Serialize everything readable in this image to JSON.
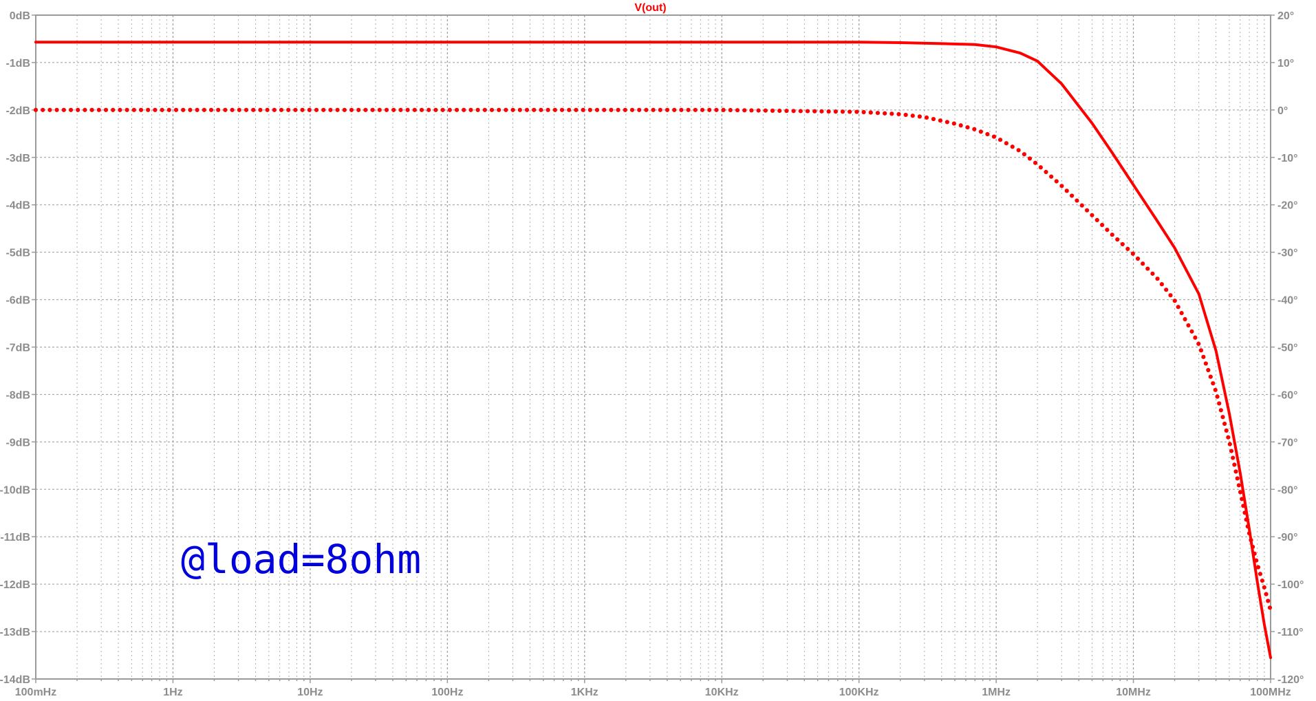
{
  "colors": {
    "trace": "#ff0000",
    "annotation": "#0000dd",
    "grid": "#9a9a9a",
    "axis": "#9a9a9a",
    "ticks": "#8c8c8c",
    "background": "#ffffff"
  },
  "chart_data": {
    "type": "line",
    "title": "V(out)",
    "annotation": "@load=8ohm",
    "xscale": "log",
    "xlim_hz": [
      0.1,
      100000000
    ],
    "x_tick_labels": [
      "100mHz",
      "1Hz",
      "10Hz",
      "100Hz",
      "1KHz",
      "10KHz",
      "100KHz",
      "1MHz",
      "10MHz",
      "100MHz"
    ],
    "ylim_left_db": [
      -14,
      0
    ],
    "y_left_tick_labels": [
      "0dB",
      "-1dB",
      "-2dB",
      "-3dB",
      "-4dB",
      "-5dB",
      "-6dB",
      "-7dB",
      "-8dB",
      "-9dB",
      "-10dB",
      "-11dB",
      "-12dB",
      "-13dB",
      "-14dB"
    ],
    "ylim_right_deg": [
      -120,
      20
    ],
    "y_right_tick_labels": [
      "20°",
      "10°",
      "0°",
      "-10°",
      "-20°",
      "-30°",
      "-40°",
      "-50°",
      "-60°",
      "-70°",
      "-80°",
      "-90°",
      "-100°",
      "-110°",
      "-120°"
    ],
    "grid": true,
    "series": [
      {
        "style": "solid",
        "axis": "left",
        "unit": "dB",
        "x": [
          0.1,
          1,
          10,
          100,
          1000,
          10000,
          100000,
          200000,
          400000,
          700000,
          1000000,
          1500000,
          2000000,
          3000000,
          5000000,
          7000000,
          10000000,
          15000000,
          20000000,
          30000000,
          40000000,
          50000000,
          60000000,
          70000000,
          80000000,
          90000000,
          100000000
        ],
        "y": [
          -0.57,
          -0.57,
          -0.57,
          -0.57,
          -0.57,
          -0.57,
          -0.57,
          -0.58,
          -0.6,
          -0.62,
          -0.67,
          -0.8,
          -0.97,
          -1.45,
          -2.28,
          -2.9,
          -3.58,
          -4.35,
          -4.91,
          -5.88,
          -7.08,
          -8.4,
          -9.65,
          -10.85,
          -11.95,
          -12.85,
          -13.55
        ]
      },
      {
        "style": "dotted",
        "axis": "right",
        "unit": "deg",
        "x": [
          0.1,
          1,
          10,
          100,
          1000,
          10000,
          100000,
          200000,
          300000,
          500000,
          700000,
          1000000,
          1500000,
          2000000,
          3000000,
          5000000,
          7000000,
          10000000,
          15000000,
          20000000,
          30000000,
          40000000,
          50000000,
          60000000,
          70000000,
          80000000,
          90000000,
          100000000
        ],
        "y": [
          0,
          0,
          0,
          0,
          0,
          0,
          -0.4,
          -0.9,
          -1.5,
          -2.9,
          -4.1,
          -5.8,
          -8.7,
          -11.5,
          -16,
          -22.2,
          -26.3,
          -30.4,
          -35.6,
          -40.2,
          -49.4,
          -59.4,
          -69.9,
          -80.4,
          -89.4,
          -95.8,
          -100.7,
          -105.5
        ]
      }
    ]
  }
}
